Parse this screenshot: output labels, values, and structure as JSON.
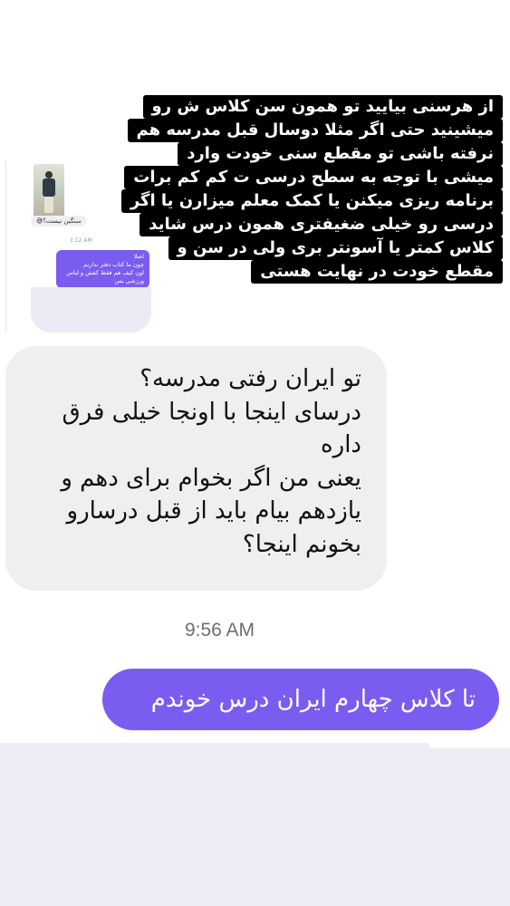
{
  "embedded_screenshot": {
    "grey_message": "سنگین نیست؟😅",
    "time": "1:12 AM",
    "purple_message_lines": [
      "اصلا",
      "چون ما کتاب دفتر نداریم",
      "اون کیف هم فقط کفش و لباس",
      "ورزشی بس"
    ]
  },
  "caption": {
    "lines": [
      "از هرسنی بیایید تو همون سن کلاس ش رو",
      "میشینید حتی اگر مثلا دوسال قبل مدرسه هم",
      "نرفته باشی تو مقطع سنی خودت وارد",
      "میشی با توجه به سطح درسی ت کم کم برات",
      "برنامه ریزی میکنن یا کمک معلم میزارن یا اگر",
      "درسی رو خیلی ضغیفتری همون درس شاید",
      "کلاس کمتر یا آسونتر بری ولی در سن و",
      "مقطع خودت در نهایت هستی"
    ]
  },
  "incoming_message": {
    "lines": [
      "تو ایران رفتی مدرسه؟",
      "درسای اینجا با اونجا خیلی فرق",
      "داره",
      "یعنی من اگر بخوام برای دهم و",
      "یازدهم بیام باید از قبل درسارو",
      "بخونم اینجا؟"
    ]
  },
  "timestamp": "9:56 AM",
  "outgoing_message": {
    "text": "تا کلاس چهارم ایران درس خوندم"
  },
  "colors": {
    "outgoing_bubble": "#7b5cf0",
    "incoming_bubble": "#efeff2",
    "caption_background": "#000000",
    "timestamp_text": "#6e6e73"
  }
}
